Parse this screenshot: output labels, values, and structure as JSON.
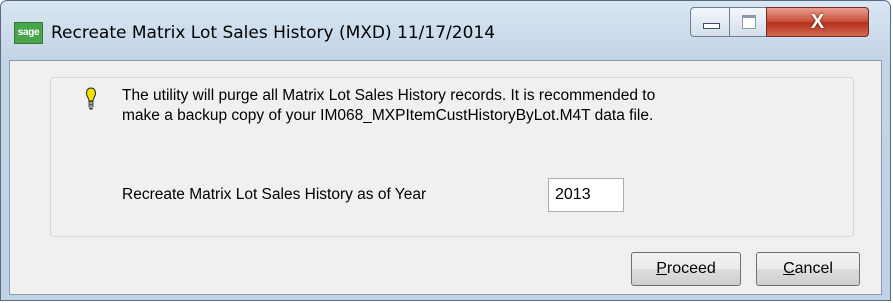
{
  "window": {
    "title": "Recreate Matrix Lot Sales History (MXD) 11/17/2014",
    "app_icon_text": "sage",
    "close_symbol": "X"
  },
  "message": {
    "line1": "The utility will purge all Matrix Lot Sales History records.  It is recommended to",
    "line2": "make a backup copy of your IM068_MXPItemCustHistoryByLot.M4T data file.",
    "icon": "lightbulb-icon"
  },
  "year_field": {
    "label": "Recreate Matrix Lot Sales History as of Year",
    "value": "2013"
  },
  "buttons": {
    "proceed_mnemonic": "P",
    "proceed_rest": "roceed",
    "cancel_mnemonic": "C",
    "cancel_rest": "ancel"
  },
  "colors": {
    "close_button": "#c64a35",
    "title_bar": "#c3d4e6",
    "bulb": "#f2e000"
  }
}
